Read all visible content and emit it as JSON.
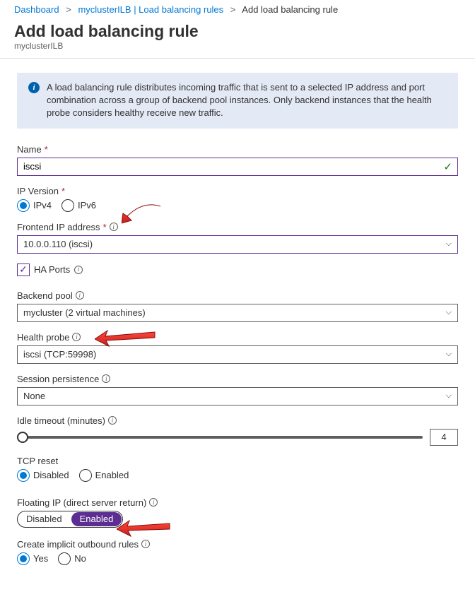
{
  "breadcrumb": {
    "dashboard": "Dashboard",
    "resource": "myclusterILB | Load balancing rules",
    "current": "Add load balancing rule"
  },
  "header": {
    "title": "Add load balancing rule",
    "subtitle": "myclusterILB"
  },
  "info": "A load balancing rule distributes incoming traffic that is sent to a selected IP address and port combination across a group of backend pool instances. Only backend instances that the health probe considers healthy receive new traffic.",
  "fields": {
    "name_label": "Name",
    "name_value": "iscsi",
    "ipversion_label": "IP Version",
    "ipv4": "IPv4",
    "ipv6": "IPv6",
    "frontend_label": "Frontend IP address",
    "frontend_value": "10.0.0.110 (iscsi)",
    "haports_label": "HA Ports",
    "backend_label": "Backend pool",
    "backend_value": "mycluster (2 virtual machines)",
    "health_label": "Health probe",
    "health_value": "iscsi (TCP:59998)",
    "session_label": "Session persistence",
    "session_value": "None",
    "idle_label": "Idle timeout (minutes)",
    "idle_value": "4",
    "tcp_label": "TCP reset",
    "disabled": "Disabled",
    "enabled": "Enabled",
    "floating_label": "Floating IP (direct server return)",
    "outbound_label": "Create implicit outbound rules",
    "yes": "Yes",
    "no": "No"
  }
}
